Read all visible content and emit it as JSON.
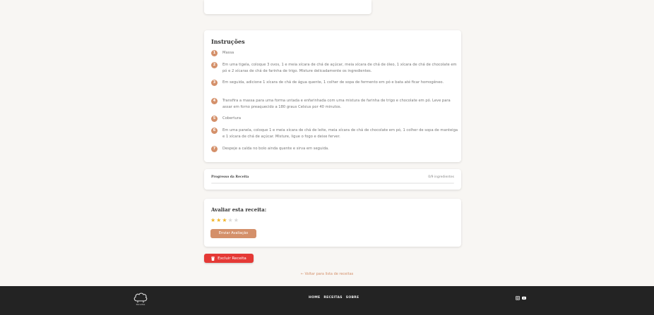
{
  "instructions": {
    "title": "Instruções",
    "steps": [
      {
        "num": "1",
        "text": "Massa"
      },
      {
        "num": "2",
        "text": "Em uma tigela, coloque 3 ovos, 1 e meia xícara de chá de açúcar, meia xícara de chá de óleo, 1 xícara de chá de chocolate em pó e 2 xícaras de chá de farinha de trigo. Misture delicadamente os ingredientes."
      },
      {
        "num": "3",
        "text": "Em seguida, adicione 1 xícara de chá de água quente, 1 colher de sopa de fermento em pó e bata até ficar homogêneo."
      },
      {
        "num": "4",
        "text": "Transfira a massa para uma forma untada e enfarinhada com uma mistura de farinha de trigo e chocolate em pó. Leve para assar em forno preaquecido a 180 graus Celsius por 40 minutos."
      },
      {
        "num": "5",
        "text": "Cobertura"
      },
      {
        "num": "6",
        "text": "Em uma panela, coloque 1 e meia xícara de chá de leite, meia xícara de chá de chocolate em pó, 1 colher de sopa de manteiga e 1 xícara de chá de açúcar. Misture, ligue o fogo e deixe ferver."
      },
      {
        "num": "7",
        "text": "Despeje a calda no bolo ainda quente e sirva em seguida."
      }
    ]
  },
  "progress": {
    "label": "Progresso da Receita",
    "count": "0/9 ingredientes",
    "fraction": 0
  },
  "rating": {
    "title": "Avaliar esta receita:",
    "value": 3,
    "max": 5,
    "submit_label": "Enviar Avaliação"
  },
  "actions": {
    "delete_label": "Excluir Receita",
    "back_label": "← Voltar para lista de receitas"
  },
  "footer": {
    "logo_text": "Receitas",
    "nav": [
      "HOME",
      "RECEITAS",
      "SOBRE"
    ],
    "social_icons": [
      "instagram-icon",
      "youtube-icon"
    ]
  },
  "colors": {
    "accent": "#d4906a",
    "danger": "#e53935",
    "footer_bg": "#232323",
    "star_on": "#f0b429"
  }
}
